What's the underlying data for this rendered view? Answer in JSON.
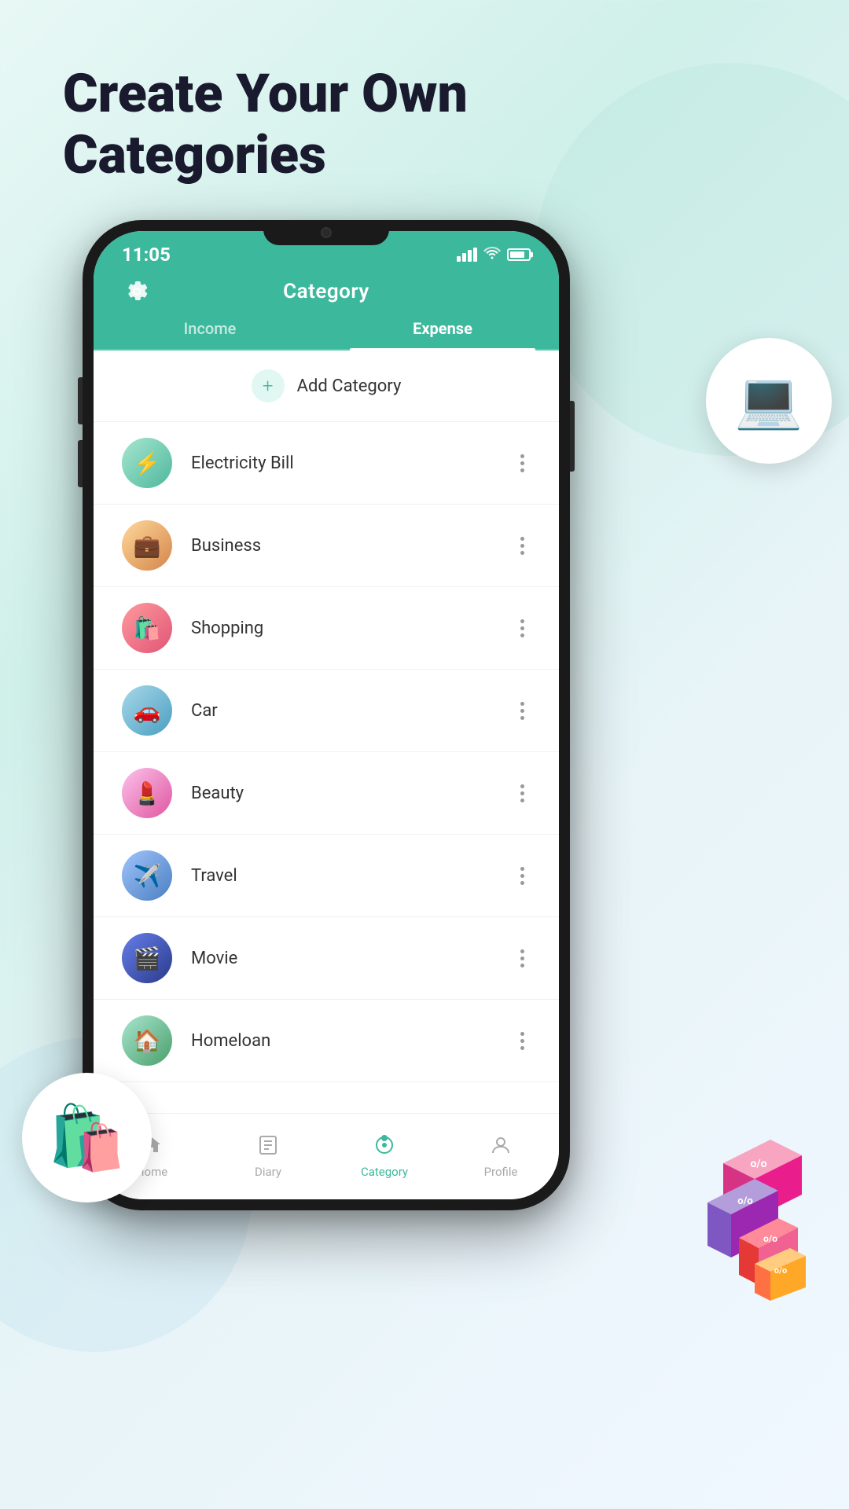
{
  "page": {
    "title_line1": "Create Your Own",
    "title_line2": "Categories"
  },
  "status_bar": {
    "time": "11:05",
    "signal": "signal",
    "wifi": "wifi",
    "battery": "battery"
  },
  "app_bar": {
    "title": "Category",
    "settings_icon": "gear-icon"
  },
  "tabs": [
    {
      "label": "Income",
      "active": false
    },
    {
      "label": "Expense",
      "active": true
    }
  ],
  "add_category": {
    "label": "Add Category",
    "plus_icon": "plus-icon"
  },
  "categories": [
    {
      "name": "Electricity Bill",
      "icon": "⚡",
      "icon_class": "icon-electricity"
    },
    {
      "name": "Business",
      "icon": "💼",
      "icon_class": "icon-business"
    },
    {
      "name": "Shopping",
      "icon": "🛍️",
      "icon_class": "icon-shopping"
    },
    {
      "name": "Car",
      "icon": "🚗",
      "icon_class": "icon-car"
    },
    {
      "name": "Beauty",
      "icon": "💄",
      "icon_class": "icon-beauty"
    },
    {
      "name": "Travel",
      "icon": "✈️",
      "icon_class": "icon-travel"
    },
    {
      "name": "Movie",
      "icon": "🎬",
      "icon_class": "icon-movie"
    },
    {
      "name": "Homeloan",
      "icon": "🏠",
      "icon_class": "icon-homeloan"
    }
  ],
  "bottom_nav": [
    {
      "label": "Home",
      "icon": "🏠",
      "active": false
    },
    {
      "label": "Diary",
      "icon": "📋",
      "active": false
    },
    {
      "label": "Category",
      "icon": "⊙",
      "active": true
    },
    {
      "label": "Profile",
      "icon": "👤",
      "active": false
    }
  ],
  "colors": {
    "header_bg": "#3cb89c",
    "accent": "#3cb89c",
    "text_primary": "#1a1a2e",
    "text_secondary": "#666",
    "bg": "#f0faf8"
  }
}
